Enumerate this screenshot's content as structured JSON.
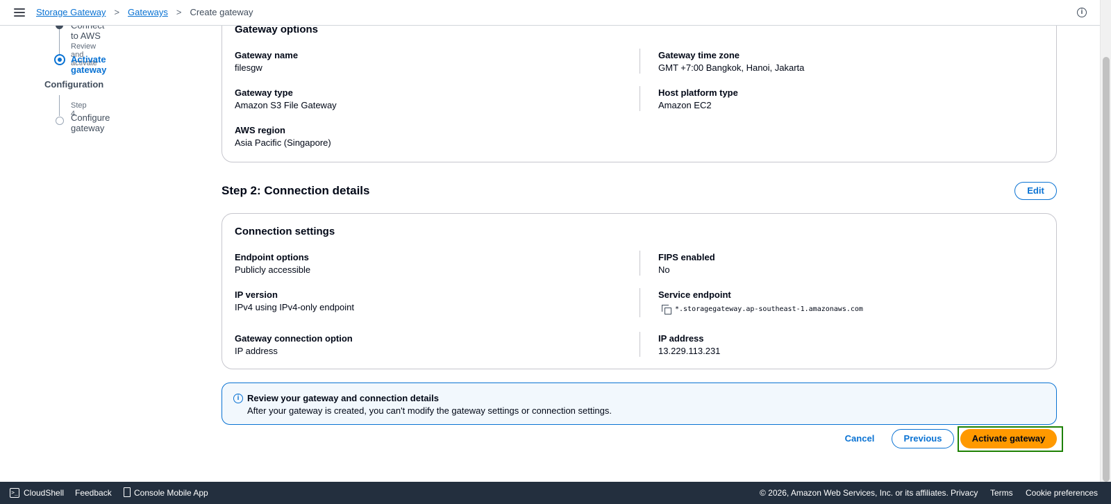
{
  "breadcrumb": {
    "items": [
      "Storage Gateway",
      "Gateways"
    ],
    "current": "Create gateway",
    "separator": ">"
  },
  "side_nav": {
    "step3_partial_title": "Connect to AWS",
    "review_label": "Review and activate",
    "active_title": "Activate gateway",
    "section_label": "Configuration",
    "step4_label": "Step 4",
    "step4_title": "Configure gateway"
  },
  "gateway_options": {
    "title": "Gateway options",
    "name_label": "Gateway name",
    "name_value": "filesgw",
    "timezone_label": "Gateway time zone",
    "timezone_value": "GMT +7:00 Bangkok, Hanoi, Jakarta",
    "type_label": "Gateway type",
    "type_value": "Amazon S3 File Gateway",
    "platform_label": "Host platform type",
    "platform_value": "Amazon EC2",
    "region_label": "AWS region",
    "region_value": "Asia Pacific (Singapore)"
  },
  "step2": {
    "heading": "Step 2: Connection details",
    "edit_label": "Edit"
  },
  "connection_settings": {
    "title": "Connection settings",
    "endpoint_label": "Endpoint options",
    "endpoint_value": "Publicly accessible",
    "fips_label": "FIPS enabled",
    "fips_value": "No",
    "ipver_label": "IP version",
    "ipver_value": "IPv4 using IPv4-only endpoint",
    "service_label": "Service endpoint",
    "service_value": "*.storagegateway.ap-southeast-1.amazonaws.com",
    "connopt_label": "Gateway connection option",
    "connopt_value": "IP address",
    "ip_label": "IP address",
    "ip_value": "13.229.113.231"
  },
  "alert": {
    "title": "Review your gateway and connection details",
    "body": "After your gateway is created, you can't modify the gateway settings or connection settings."
  },
  "actions": {
    "cancel": "Cancel",
    "previous": "Previous",
    "activate": "Activate gateway"
  },
  "footer": {
    "cloudshell": "CloudShell",
    "feedback": "Feedback",
    "mobile_app": "Console Mobile App",
    "copyright": "© 2026, Amazon Web Services, Inc. or its affiliates.",
    "privacy": "Privacy",
    "terms": "Terms",
    "cookies": "Cookie preferences"
  },
  "colors": {
    "link": "#0972d3",
    "primary": "#ff9900",
    "footer_bg": "#232f3e",
    "highlight": "#1d8102"
  }
}
